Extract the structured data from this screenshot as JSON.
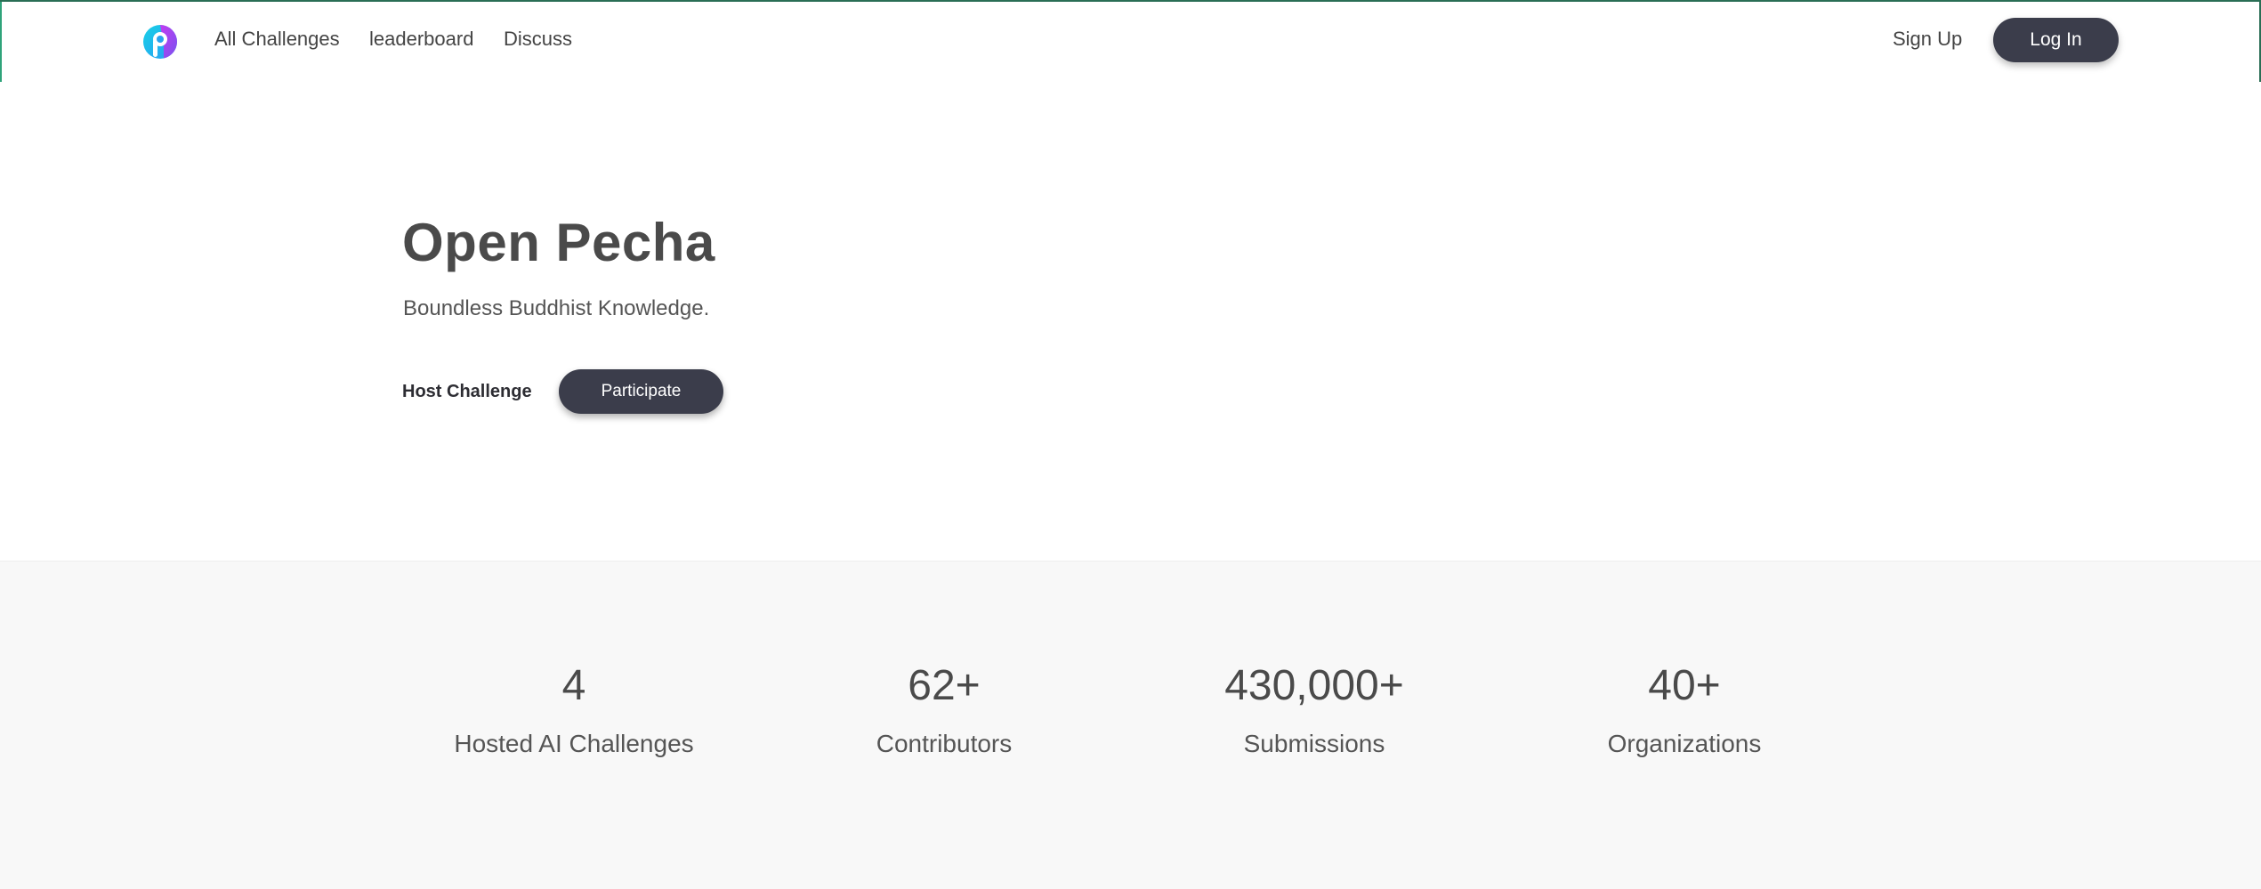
{
  "header": {
    "logo_icon": "open-pecha-logo-icon",
    "nav": [
      {
        "label": "All Challenges"
      },
      {
        "label": "leaderboard"
      },
      {
        "label": "Discuss"
      }
    ],
    "signup_label": "Sign Up",
    "login_label": "Log In"
  },
  "hero": {
    "title": "Open Pecha",
    "subtitle": "Boundless Buddhist Knowledge.",
    "host_label": "Host Challenge",
    "participate_label": "Participate"
  },
  "stats": [
    {
      "value": "4",
      "label": "Hosted AI Challenges"
    },
    {
      "value": "62+",
      "label": "Contributors"
    },
    {
      "value": "430,000+",
      "label": "Submissions"
    },
    {
      "value": "40+",
      "label": "Organizations"
    }
  ],
  "colors": {
    "primary_button": "#3b3d4b",
    "stats_background": "#f8f8f8",
    "logo_cyan": "#1cc8e8",
    "logo_purple": "#a64cf0"
  }
}
